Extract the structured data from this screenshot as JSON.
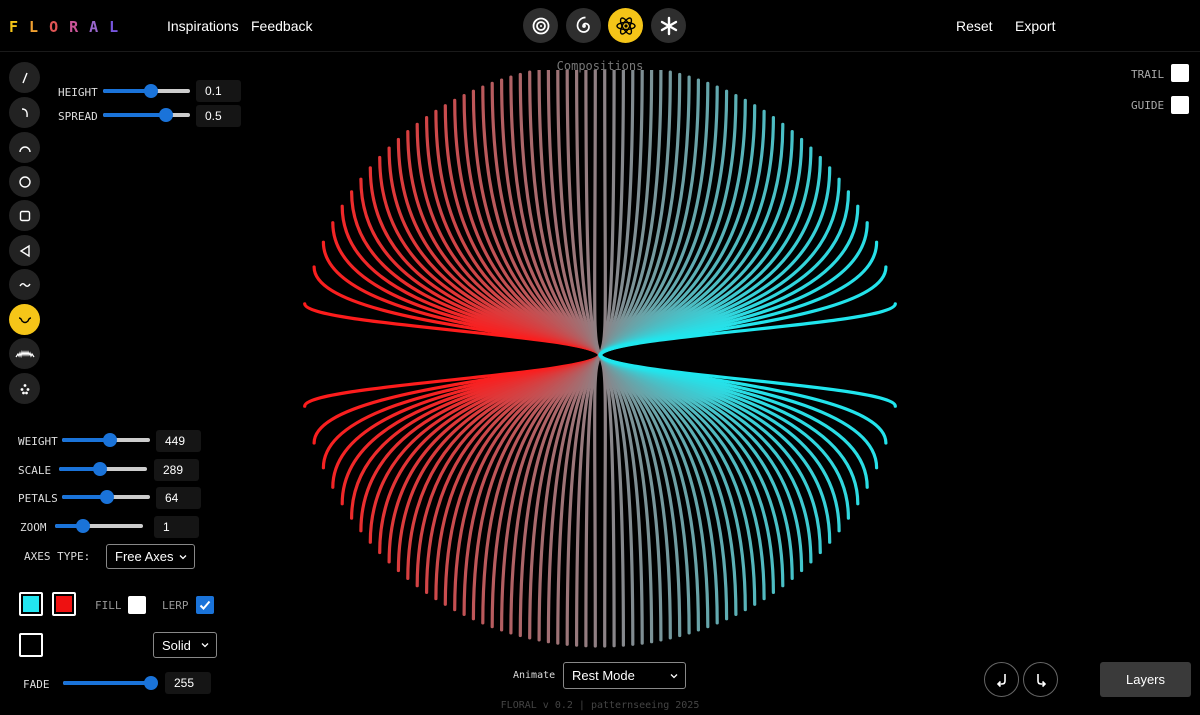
{
  "header": {
    "logo_letters": [
      {
        "ch": "F",
        "color": "#f5c518"
      },
      {
        "ch": "L",
        "color": "#f0a030"
      },
      {
        "ch": "O",
        "color": "#e05555"
      },
      {
        "ch": "R",
        "color": "#cc5599"
      },
      {
        "ch": "A",
        "color": "#9966cc"
      },
      {
        "ch": "L",
        "color": "#7755dd"
      }
    ],
    "nav": {
      "inspirations": "Inspirations",
      "feedback": "Feedback"
    },
    "actions": {
      "reset": "Reset",
      "export": "Export"
    },
    "modes": [
      "concentric-icon",
      "spiral-icon",
      "atom-icon",
      "asterisk-icon"
    ],
    "active_mode": 2
  },
  "canvas_title": "Compositions",
  "tools": [
    "line-icon",
    "curve-icon",
    "arc-icon",
    "circle-icon",
    "square-icon",
    "triangle-icon",
    "wave-icon",
    "smile-curve-icon",
    "zigzag-icon",
    "sparkle-icon"
  ],
  "active_tool": 7,
  "shape_controls": {
    "height": {
      "label": "HEIGHT",
      "value": "0.1",
      "fraction": 0.55
    },
    "spread": {
      "label": "SPREAD",
      "value": "0.5",
      "fraction": 0.72
    }
  },
  "pattern_controls": {
    "weight": {
      "label": "WEIGHT",
      "value": "449",
      "fraction": 0.55
    },
    "scale": {
      "label": "SCALE",
      "value": "289",
      "fraction": 0.47
    },
    "petals": {
      "label": "PETALS",
      "value": "64",
      "fraction": 0.51
    },
    "zoom": {
      "label": "ZOOM",
      "value": "1",
      "fraction": 0.32
    }
  },
  "axes": {
    "label": "AXES TYPE:",
    "value": "Free Axes"
  },
  "colors": {
    "primary": "#22e5f0",
    "secondary": "#ee1111",
    "stroke": "#000000"
  },
  "fill": {
    "label": "FILL",
    "checked": false
  },
  "lerp": {
    "label": "LERP",
    "checked": true
  },
  "line_style": "Solid",
  "fade": {
    "label": "FADE",
    "value": "255",
    "fraction": 1.0
  },
  "right_toggles": {
    "trail": {
      "label": "TRAIL",
      "checked": false
    },
    "guide": {
      "label": "GUIDE",
      "checked": false
    }
  },
  "animate": {
    "label": "Animate",
    "value": "Rest Mode"
  },
  "layers_label": "Layers",
  "footer": "FLORAL v 0.2 | patternseeing 2025",
  "floral": {
    "petals": 64,
    "color_start": "#ff1a1a",
    "color_end": "#1ee8f0"
  }
}
